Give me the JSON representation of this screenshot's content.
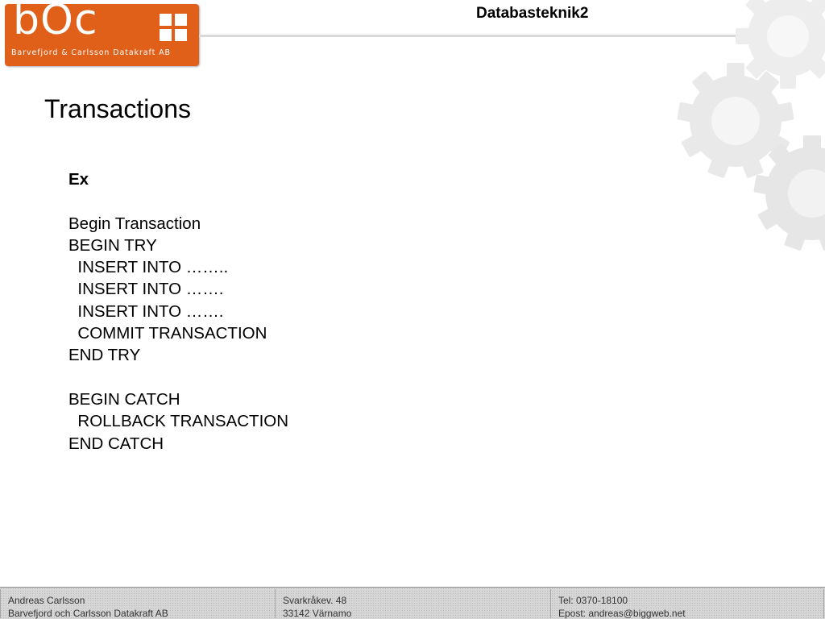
{
  "logo": {
    "mark": "bOc",
    "company": "Barvefjord & Carlsson Datakraft AB",
    "color": "#e0601a"
  },
  "header": {
    "course_title": "Databasteknik2"
  },
  "slide": {
    "title": "Transactions",
    "body_lines": [
      "Ex",
      "",
      "Begin Transaction",
      "BEGIN TRY",
      "  INSERT INTO ……..",
      "  INSERT INTO …….",
      "  INSERT INTO …….",
      "  COMMIT TRANSACTION",
      "END TRY",
      "",
      "BEGIN CATCH",
      "  ROLLBACK TRANSACTION",
      "END CATCH"
    ]
  },
  "footer": {
    "author_name": "Andreas Carlsson",
    "author_company": "Barvefjord och Carlsson Datakraft AB",
    "street": "Svarkråkev. 48",
    "postal": "33142 Värnamo",
    "phone": "Tel: 0370-18100",
    "email": "Epost: andreas@biggweb.net"
  }
}
